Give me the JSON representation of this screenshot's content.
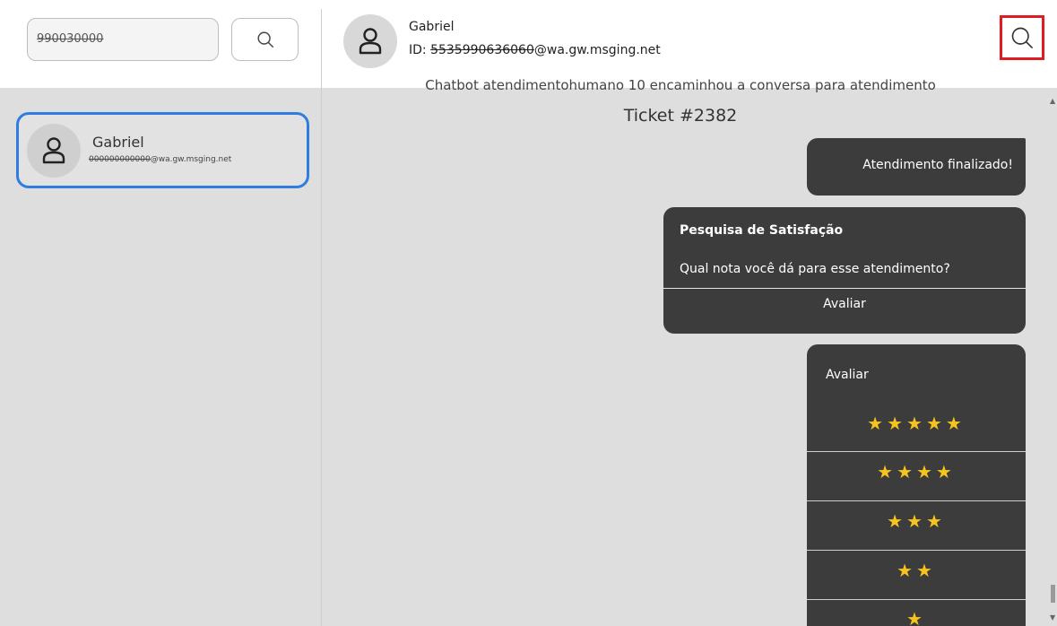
{
  "sidebar": {
    "search_value": "990030000",
    "contact": {
      "name": "Gabriel",
      "id_masked": "000000000000",
      "id_domain": "@wa.gw.msging.net"
    }
  },
  "chat_header": {
    "name": "Gabriel",
    "id_prefix": "ID: ",
    "id_masked": "5535990636060",
    "id_domain": "@wa.gw.msging.net"
  },
  "messages": {
    "cut_line": "Chatbot atendimentohumano 10 encaminhou a conversa para atendimento",
    "ticket": "Ticket #2382",
    "finalizado": "Atendimento finalizado!",
    "survey": {
      "title": "Pesquisa de Satisfação",
      "question": "Qual nota você dá para esse atendimento?",
      "button": "Avaliar"
    },
    "rating": {
      "title": "Avaliar",
      "options": [
        "★★★★★",
        "★★★★",
        "★★★",
        "★★",
        "★"
      ]
    }
  },
  "icons": {
    "search": "search-icon",
    "avatar": "user-icon"
  },
  "colors": {
    "accent_blue": "#2f7de1",
    "highlight_red": "#e01b22",
    "bubble_dark": "#3c3c3c",
    "star_yellow": "#f7c41f"
  }
}
